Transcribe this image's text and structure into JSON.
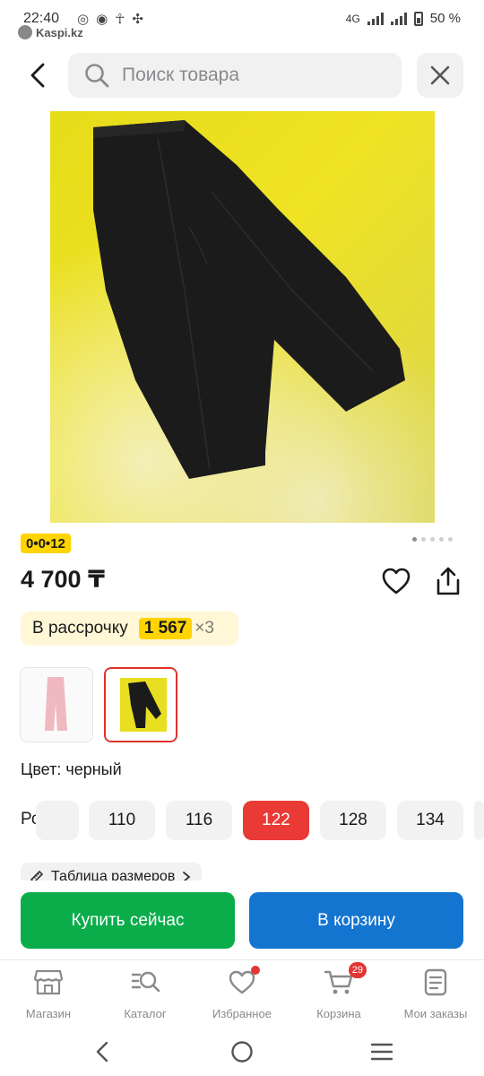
{
  "status_bar": {
    "time": "22:40",
    "network": "4G",
    "battery": "50 %",
    "back_app_label": "Kaspi.kz"
  },
  "search": {
    "placeholder": "Поиск товара"
  },
  "product": {
    "installment_badge": "0•0•12",
    "carousel": {
      "total": 5,
      "active_index": 0
    },
    "price": "4 700 ₸",
    "installment": {
      "label": "В рассрочку",
      "amount": "1 567",
      "multiplier": "×3"
    },
    "color_label": "Цвет: черный",
    "size": {
      "title": "Рост",
      "options": [
        "110",
        "116",
        "122",
        "128",
        "134"
      ],
      "selected": "122"
    },
    "size_table_link": "Таблица размеров"
  },
  "actions": {
    "buy_now": "Купить сейчас",
    "add_to_cart": "В корзину"
  },
  "tab_bar": {
    "items": [
      {
        "label": "Магазин",
        "icon": "store-icon"
      },
      {
        "label": "Каталог",
        "icon": "catalog-icon"
      },
      {
        "label": "Избранное",
        "icon": "heart-icon"
      },
      {
        "label": "Корзина",
        "icon": "cart-icon",
        "badge": "29"
      },
      {
        "label": "Мои заказы",
        "icon": "orders-icon"
      }
    ]
  },
  "colors": {
    "buy_green": "#0bad4b",
    "cart_blue": "#1475d0",
    "selected_red": "#ea3a35",
    "installment_yellow": "#ffd400",
    "badge_red": "#e43535"
  }
}
